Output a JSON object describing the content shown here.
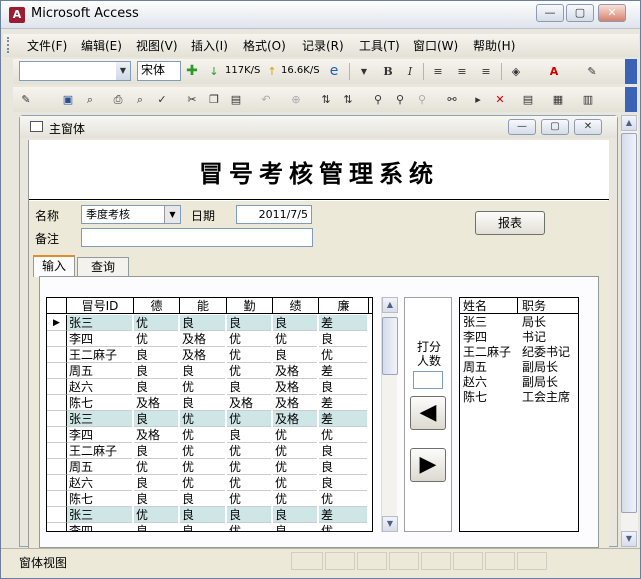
{
  "app": {
    "title": "Microsoft Access"
  },
  "menu": [
    "文件(F)",
    "编辑(E)",
    "视图(V)",
    "插入(I)",
    "格式(O)",
    "记录(R)",
    "工具(T)",
    "窗口(W)",
    "帮助(H)"
  ],
  "toolbar": {
    "font_name": "宋体",
    "down_speed": "117K/S",
    "up_speed": "16.6K/S"
  },
  "form_window": {
    "title": "主窗体"
  },
  "form": {
    "header_title": "冒号考核管理系统",
    "name_label": "名称",
    "name_value": "季度考核",
    "date_label": "日期",
    "date_value": "2011/7/5",
    "note_label": "备注",
    "note_value": "",
    "report_button": "报表",
    "tabs": [
      "输入",
      "查询"
    ],
    "grid": {
      "columns": [
        "冒号ID",
        "德",
        "能",
        "勤",
        "绩",
        "廉"
      ],
      "rows": [
        [
          "张三",
          "优",
          "良",
          "良",
          "良",
          "差"
        ],
        [
          "李四",
          "优",
          "及格",
          "优",
          "优",
          "良"
        ],
        [
          "王二麻子",
          "良",
          "及格",
          "优",
          "良",
          "优"
        ],
        [
          "周五",
          "良",
          "良",
          "优",
          "及格",
          "差"
        ],
        [
          "赵六",
          "良",
          "优",
          "良",
          "及格",
          "良"
        ],
        [
          "陈七",
          "及格",
          "良",
          "及格",
          "及格",
          "差"
        ],
        [
          "张三",
          "良",
          "优",
          "优",
          "及格",
          "差"
        ],
        [
          "李四",
          "及格",
          "优",
          "良",
          "优",
          "优"
        ],
        [
          "王二麻子",
          "良",
          "优",
          "优",
          "优",
          "良"
        ],
        [
          "周五",
          "优",
          "优",
          "优",
          "优",
          "良"
        ],
        [
          "赵六",
          "良",
          "优",
          "优",
          "优",
          "良"
        ],
        [
          "陈七",
          "良",
          "良",
          "优",
          "优",
          "优"
        ],
        [
          "张三",
          "优",
          "良",
          "良",
          "良",
          "差"
        ],
        [
          "李四",
          "良",
          "良",
          "优",
          "良",
          "优"
        ]
      ]
    },
    "score_label": "打分\n人数",
    "score_value": "",
    "left_arrow": "◀",
    "right_arrow": "▶",
    "list": {
      "columns": [
        "姓名",
        "职务"
      ],
      "rows": [
        [
          "张三",
          "局长"
        ],
        [
          "李四",
          "书记"
        ],
        [
          "王二麻子",
          "纪委书记"
        ],
        [
          "周五",
          "副局长"
        ],
        [
          "赵六",
          "副局长"
        ],
        [
          "陈七",
          "工会主席"
        ]
      ]
    }
  },
  "status": {
    "text": "窗体视图"
  },
  "colors": {
    "highlight": "#cfe6e6",
    "title_accent": "#9b1b30"
  }
}
